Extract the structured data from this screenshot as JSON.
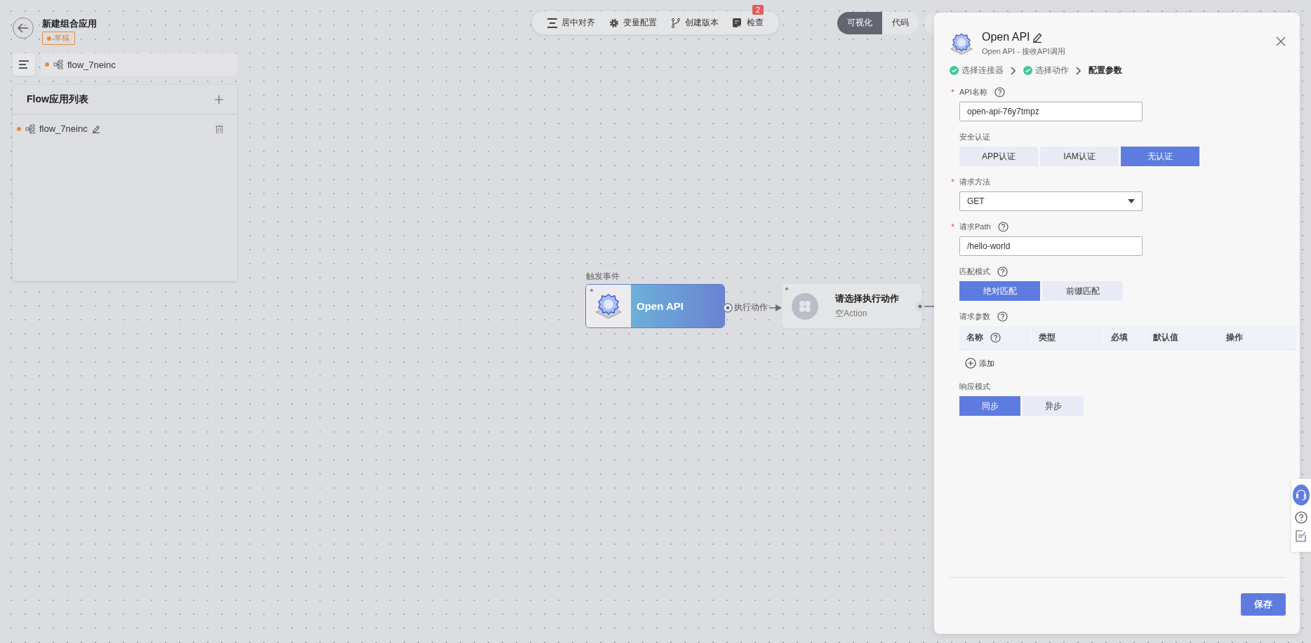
{
  "header": {
    "title": "新建组合应用",
    "status": "草稿"
  },
  "flow_tabs": [
    {
      "label": "flow_7neinc"
    }
  ],
  "flow_list": {
    "title": "Flow应用列表",
    "items": [
      {
        "label": "flow_7neinc"
      }
    ]
  },
  "toolbar": [
    {
      "kind": "align",
      "label": "居中对齐"
    },
    {
      "kind": "settings",
      "label": "变量配置"
    },
    {
      "kind": "branch",
      "label": "创建版本"
    },
    {
      "kind": "check",
      "label": "检查",
      "badge": "2"
    }
  ],
  "view_toggle": [
    {
      "label": "可视化",
      "selected": true
    },
    {
      "label": "代码",
      "selected": false
    }
  ],
  "canvas": {
    "trigger_label": "触发事件",
    "trigger_node": {
      "title": "Open API"
    },
    "edge_label": "执行动作",
    "action_node": {
      "title": "请选择执行动作",
      "subtitle": "空Action"
    }
  },
  "drawer": {
    "title": "Open API",
    "subtitle": "Open API - 接收API调用",
    "steps": [
      {
        "label": "选择连接器",
        "done": true
      },
      {
        "label": "选择动作",
        "done": true
      },
      {
        "label": "配置参数",
        "done": false
      }
    ],
    "fields": [
      {
        "kind": "input",
        "label": "API名称",
        "required_mark": "*",
        "help": true,
        "value": "open-api-76y7tmpz"
      },
      {
        "kind": "segmented",
        "label": "安全认证",
        "help": false,
        "options": [
          {
            "label": "APP认证",
            "selected": false
          },
          {
            "label": "IAM认证",
            "selected": false
          },
          {
            "label": "无认证",
            "selected": true
          }
        ]
      },
      {
        "kind": "select",
        "label": "请求方法",
        "required_mark": "*",
        "help": false,
        "value": "GET"
      },
      {
        "kind": "input",
        "label": "请求Path",
        "required_mark": "*",
        "help": true,
        "value": "/hello-world"
      },
      {
        "kind": "segmented",
        "label": "匹配模式",
        "help": true,
        "options": [
          {
            "label": "绝对匹配",
            "selected": true
          },
          {
            "label": "前缀匹配",
            "selected": false
          }
        ]
      },
      {
        "kind": "table",
        "label": "请求参数",
        "help": true,
        "columns": [
          {
            "label": "名称",
            "help": true
          },
          {
            "label": "类型",
            "help": false
          },
          {
            "label": "必填",
            "help": false
          },
          {
            "label": "默认值",
            "help": false
          },
          {
            "label": "操作",
            "help": false
          }
        ],
        "add_label": "添加"
      },
      {
        "kind": "segmented",
        "label": "响应模式",
        "help": false,
        "options": [
          {
            "label": "同步",
            "selected": true
          },
          {
            "label": "异步",
            "selected": false
          }
        ]
      }
    ],
    "save": "保存"
  }
}
